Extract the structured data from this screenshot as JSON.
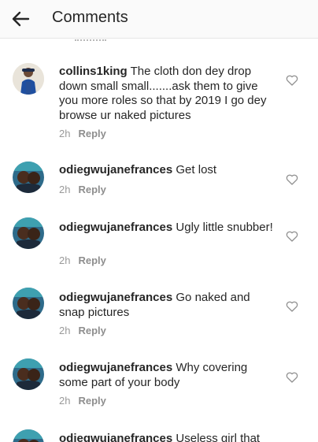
{
  "header": {
    "title": "Comments"
  },
  "comments": [
    {
      "user": "collins1king",
      "text": "The cloth don dey drop down small small.......ask them to give you more roles so that by 2019 I go dey browse ur naked pictures",
      "time": "2h",
      "reply": "Reply"
    },
    {
      "user": "odiegwujanefrances",
      "text": "Get lost",
      "time": "2h",
      "reply": "Reply"
    },
    {
      "user": "odiegwujanefrances",
      "text": "Ugly little snubber!",
      "time": "2h",
      "reply": "Reply"
    },
    {
      "user": "odiegwujanefrances",
      "text": "Go naked and snap pictures",
      "time": "2h",
      "reply": "Reply"
    },
    {
      "user": "odiegwujanefrances",
      "text": "Why covering some part of your body",
      "time": "2h",
      "reply": "Reply"
    },
    {
      "user": "odiegwujanefrances",
      "text": "Useless girl that",
      "time": "",
      "reply": ""
    }
  ],
  "icons": {
    "back": "arrow-left-icon",
    "like": "heart-outline-icon"
  },
  "colors": {
    "text": "#262626",
    "meta": "#999999",
    "header_bg": "#fafafa"
  }
}
